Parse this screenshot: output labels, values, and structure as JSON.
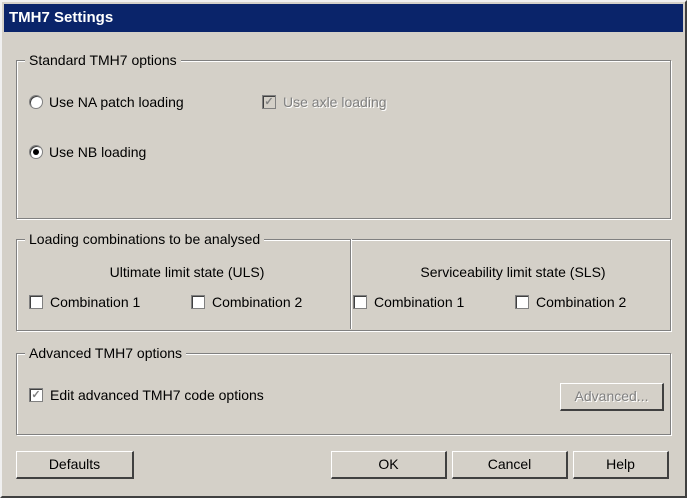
{
  "window": {
    "title": "TMH7 Settings"
  },
  "standard": {
    "legend": "Standard TMH7 options",
    "radio_na": "Use NA patch loading",
    "radio_nb": "Use NB loading",
    "axle": "Use axle loading"
  },
  "loading": {
    "legend": "Loading combinations to be analysed",
    "uls_title": "Ultimate limit state (ULS)",
    "sls_title": "Serviceability limit state (SLS)",
    "uls_c1": "Combination 1",
    "uls_c2": "Combination 2",
    "sls_c1": "Combination 1",
    "sls_c2": "Combination 2"
  },
  "advanced": {
    "legend": "Advanced TMH7 options",
    "edit": "Edit advanced TMH7 code options",
    "button": "Advanced..."
  },
  "buttons": {
    "defaults": "Defaults",
    "ok": "OK",
    "cancel": "Cancel",
    "help": "Help"
  },
  "check_glyph": "✓"
}
